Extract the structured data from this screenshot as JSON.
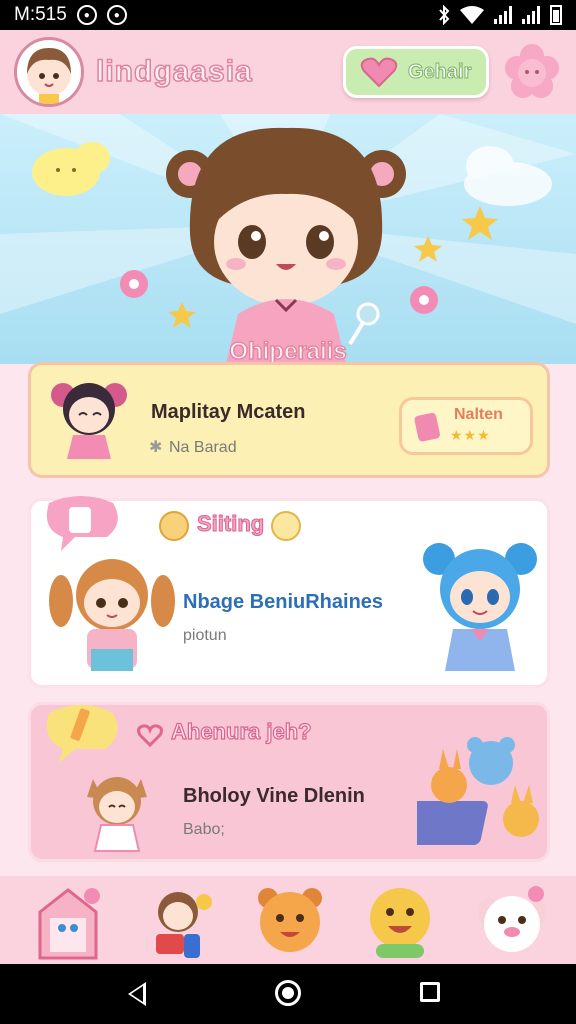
{
  "status_bar": {
    "time": "M:515"
  },
  "header": {
    "app_title": "lindgaasia",
    "action_label": "Gehair"
  },
  "hero": {
    "title": "Ohiperaiis"
  },
  "cards": [
    {
      "title": "Maplitay Mcaten",
      "subtitle": "Na Barad",
      "reward_label": "Nalten",
      "stars": "★★★"
    },
    {
      "heading": "Siiting",
      "title": "Nbage BeniuRhaines",
      "subtitle": "piotun"
    },
    {
      "heading": "Ahenura jeh?",
      "title": "Bholoy Vine Dlenin",
      "subtitle": "Babo;"
    }
  ],
  "colors": {
    "pink": "#f08ab0",
    "header_bg": "#fbd3de",
    "hero_bg": "#a8def2",
    "card_yellow": "#fcf0b4",
    "card_pink": "#f9c6d6",
    "green_button": "#c9ecb0"
  },
  "icons": [
    "wifi-icon",
    "signal-icon",
    "battery-icon",
    "bluetooth-icon",
    "heart-icon",
    "flower-icon",
    "star-icon",
    "cloud-icon",
    "back-icon",
    "home-icon",
    "recent-apps-icon"
  ]
}
